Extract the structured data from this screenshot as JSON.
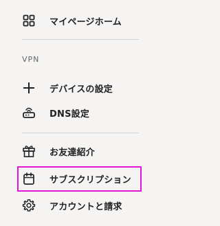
{
  "menu": {
    "items": [
      {
        "label": "マイページホーム",
        "icon": "grid-icon"
      },
      {
        "label": "デバイスの設定",
        "icon": "plus-icon"
      },
      {
        "label": "DNS設定",
        "icon": "router-icon"
      },
      {
        "label": "お友達紹介",
        "icon": "gift-icon"
      },
      {
        "label": "サブスクリプション",
        "icon": "calendar-icon"
      },
      {
        "label": "アカウントと請求",
        "icon": "gear-icon"
      }
    ],
    "section_vpn": "VPN"
  },
  "colors": {
    "background": "#f5f4f3",
    "text": "#222222",
    "divider": "#cfcfcf",
    "highlight": "#e316d6"
  }
}
